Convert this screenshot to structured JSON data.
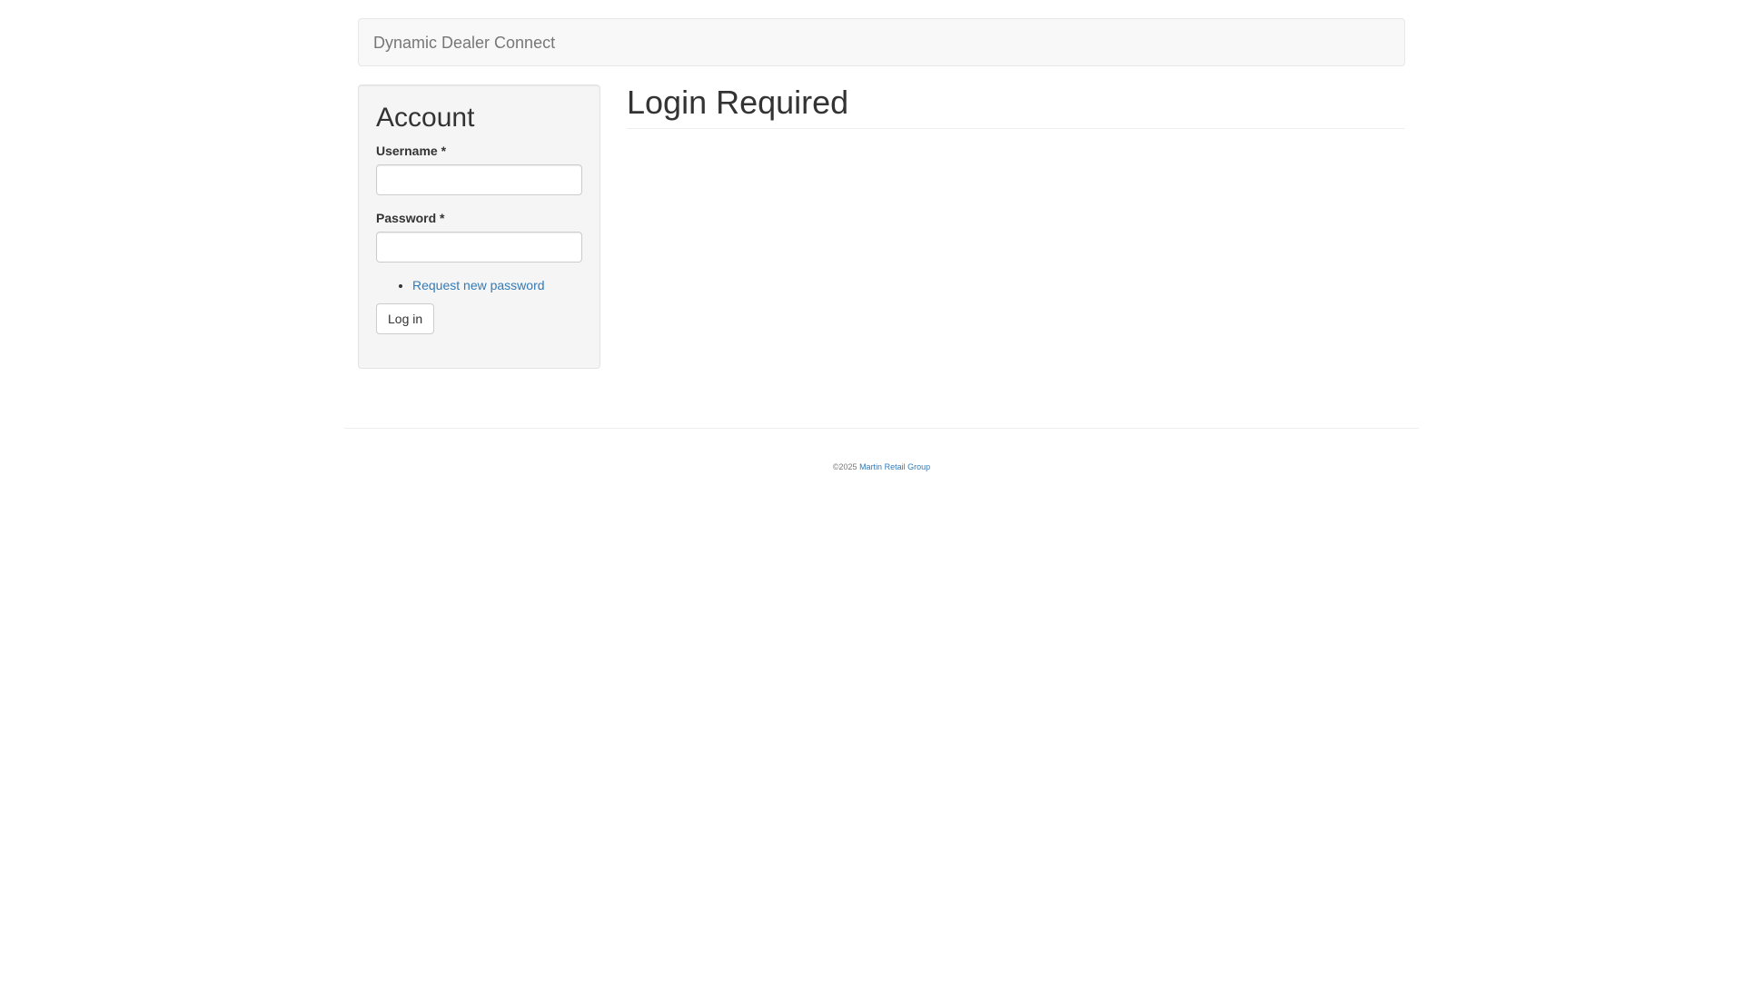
{
  "navbar": {
    "brand": "Dynamic Dealer Connect"
  },
  "sidebar": {
    "title": "Account",
    "username_label": "Username",
    "password_label": "Password",
    "required_marker": "*",
    "username_value": "",
    "password_value": "",
    "links": [
      {
        "label": "Request new password"
      }
    ],
    "login_button": "Log in"
  },
  "main": {
    "title": "Login Required"
  },
  "footer": {
    "copyright": "©2025",
    "company": "Martin Retail Group"
  },
  "colors": {
    "link": "#337ab7",
    "panel_bg": "#f5f5f5",
    "navbar_bg": "#f8f8f8"
  }
}
